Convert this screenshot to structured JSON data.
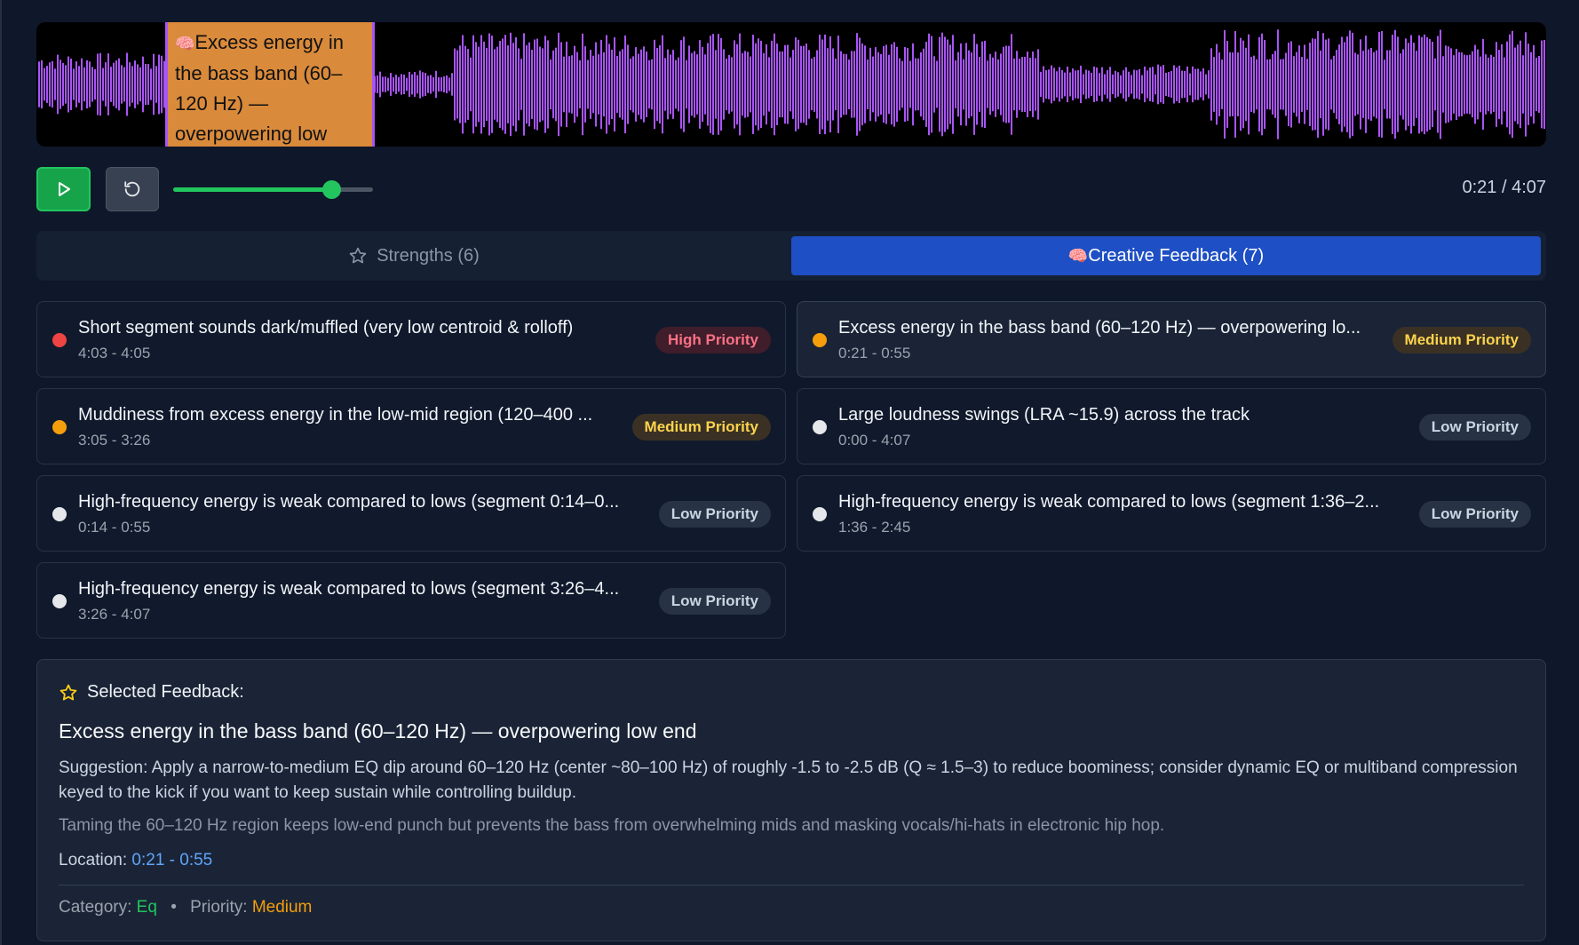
{
  "player": {
    "region_label": "Excess energy in the bass band (60–120 Hz) — overpowering low",
    "region_icon": "brain-icon",
    "progress": 0.79,
    "current_time": "0:21",
    "total_time": "4:07",
    "time_display": "0:21 / 4:07",
    "waveform_color": "#a855f7",
    "region_color": "#d98a3b"
  },
  "tabs": {
    "strengths": "Strengths (6)",
    "creative": "Creative Feedback (7)",
    "active": "creative"
  },
  "feedback_items": [
    {
      "title": "Short segment sounds dark/muffled (very low centroid & rolloff)",
      "time": "4:03 - 4:05",
      "priority": "High Priority",
      "level": "high"
    },
    {
      "title": "Excess energy in the bass band (60–120 Hz) — overpowering lo...",
      "time": "0:21 - 0:55",
      "priority": "Medium Priority",
      "level": "medium"
    },
    {
      "title": "Muddiness from excess energy in the low-mid region (120–400 ...",
      "time": "3:05 - 3:26",
      "priority": "Medium Priority",
      "level": "medium"
    },
    {
      "title": "Large loudness swings (LRA ~15.9) across the track",
      "time": "0:00 - 4:07",
      "priority": "Low Priority",
      "level": "low"
    },
    {
      "title": "High-frequency energy is weak compared to lows (segment 0:14–0...",
      "time": "0:14 - 0:55",
      "priority": "Low Priority",
      "level": "low"
    },
    {
      "title": "High-frequency energy is weak compared to lows (segment 1:36–2...",
      "time": "1:36 - 2:45",
      "priority": "Low Priority",
      "level": "low"
    },
    {
      "title": "High-frequency energy is weak compared to lows (segment 3:26–4...",
      "time": "3:26 - 4:07",
      "priority": "Low Priority",
      "level": "low"
    }
  ],
  "priority_colors": {
    "high": "#ef4444",
    "medium": "#f59e0b",
    "low": "#e5e7eb"
  },
  "detail": {
    "heading": "Selected Feedback:",
    "title": "Excess energy in the bass band (60–120 Hz) — overpowering low end",
    "suggestion": "Suggestion: Apply a narrow-to-medium EQ dip around 60–120 Hz (center ~80–100 Hz) of roughly -1.5 to -2.5 dB (Q ≈ 1.5–3) to reduce boominess; consider dynamic EQ or multiband compression keyed to the kick if you want to keep sustain while controlling buildup.",
    "note": "Taming the 60–120 Hz region keeps low-end punch but prevents the bass from overwhelming mids and masking vocals/hi-hats in electronic hip hop.",
    "location_label": "Location:",
    "location_value": "0:21 - 0:55",
    "category_label": "Category:",
    "category_value": "Eq",
    "separator": "•",
    "priority_label": "Priority:",
    "priority_value": "Medium"
  }
}
